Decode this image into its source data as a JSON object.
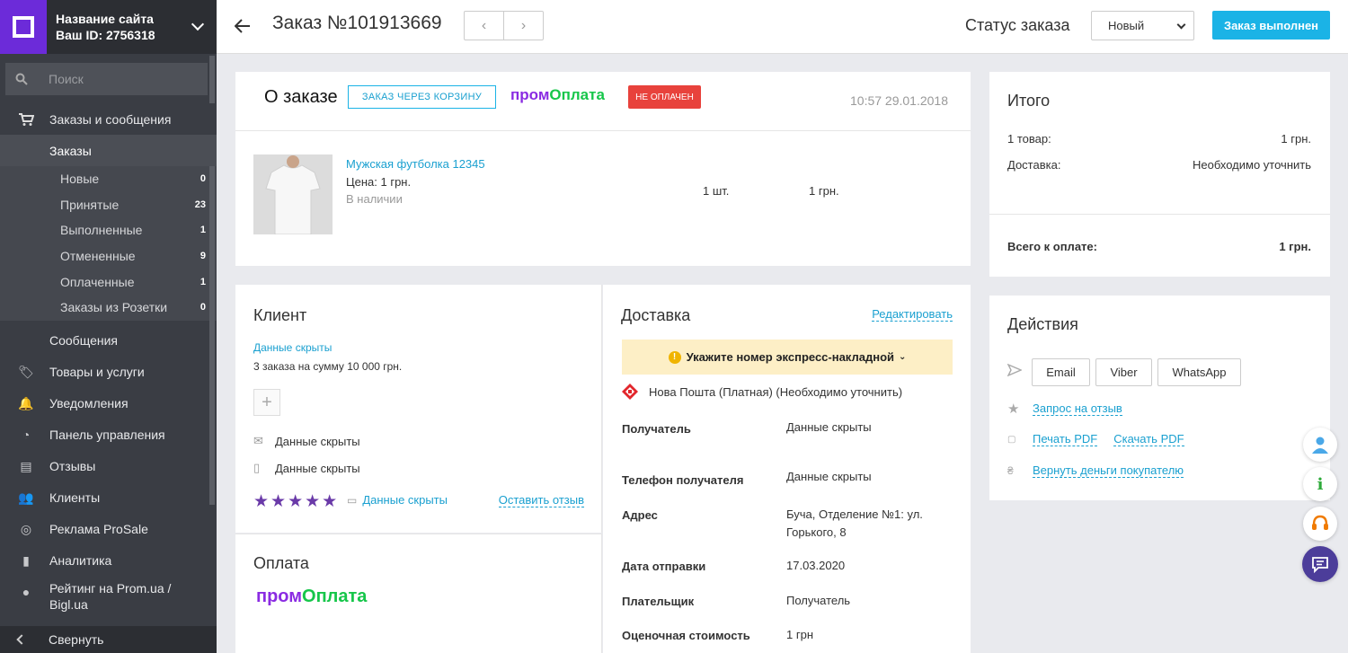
{
  "sidebar": {
    "site_name": "Название сайта",
    "site_id": "Ваш ID: 2756318",
    "search_placeholder": "Поиск",
    "orders_group": "Заказы и сообщения",
    "orders": "Заказы",
    "sub": [
      {
        "label": "Новые",
        "count": "0"
      },
      {
        "label": "Принятые",
        "count": "23"
      },
      {
        "label": "Выполненные",
        "count": "1"
      },
      {
        "label": "Отмененные",
        "count": "9"
      },
      {
        "label": "Оплаченные",
        "count": "1"
      },
      {
        "label": "Заказы из Розетки",
        "count": "0"
      }
    ],
    "messages": "Сообщения",
    "items": [
      "Товары и услуги",
      "Уведомления",
      "Панель управления",
      "Отзывы",
      "Клиенты",
      "Реклама ProSale",
      "Аналитика"
    ],
    "rating_line1": "Рейтинг на Prom.ua /",
    "rating_line2": "Bigl.ua",
    "collapse": "Свернуть"
  },
  "topbar": {
    "title": "Заказ №101913669",
    "status_label": "Статус заказа",
    "status_value": "Новый",
    "done_button": "Заказ выполнен"
  },
  "about": {
    "title": "О заказе",
    "cart_badge": "ЗАКАЗ ЧЕРЕЗ КОРЗИНУ",
    "prom_a": "пром",
    "prom_b": "Оплата",
    "unpaid": "НЕ ОПЛАЧЕН",
    "date": "10:57 29.01.2018",
    "product": {
      "name": "Мужская футболка 12345",
      "price": "Цена: 1 грн.",
      "stock": "В наличии",
      "qty": "1 шт.",
      "sum": "1 грн."
    }
  },
  "client": {
    "title": "Клиент",
    "hidden": "Данные скрыты",
    "orders": "3 заказа на сумму 10 000 грн.",
    "email": "Данные скрыты",
    "phone": "Данные скрыты",
    "stars": "★★★★★",
    "review_text": "Данные скрыты",
    "leave_review": "Оставить отзыв"
  },
  "payment": {
    "title": "Оплата",
    "prom_a": "пром",
    "prom_b": "Оплата"
  },
  "delivery": {
    "title": "Доставка",
    "edit": "Редактировать",
    "warning": "Укажите номер экспресс-накладной",
    "carrier": "Нова Пошта (Платная) (Необходимо уточнить)",
    "recipient_k": "Получатель",
    "recipient_v": "Данные скрыты",
    "phone_k": "Телефон получателя",
    "phone_v": "Данные скрыты",
    "address_k": "Адрес",
    "address_v": "Буча, Отделение №1: ул. Горького, 8",
    "date_k": "Дата отправки",
    "date_v": "17.03.2020",
    "payer_k": "Плательщик",
    "payer_v": "Получатель",
    "cost_k": "Оценочная стоимость",
    "cost_v": "1 грн"
  },
  "totals": {
    "title": "Итого",
    "items_k": "1 товар:",
    "items_v": "1 грн.",
    "delivery_k": "Доставка:",
    "delivery_v": "Необходимо уточнить",
    "total_k": "Всего к оплате:",
    "total_v": "1 грн."
  },
  "actions": {
    "title": "Действия",
    "email": "Email",
    "viber": "Viber",
    "whatsapp": "WhatsApp",
    "review_request": "Запрос на отзыв",
    "print_pdf": "Печать PDF",
    "download_pdf": "Скачать PDF",
    "refund": "Вернуть деньги покупателю"
  }
}
